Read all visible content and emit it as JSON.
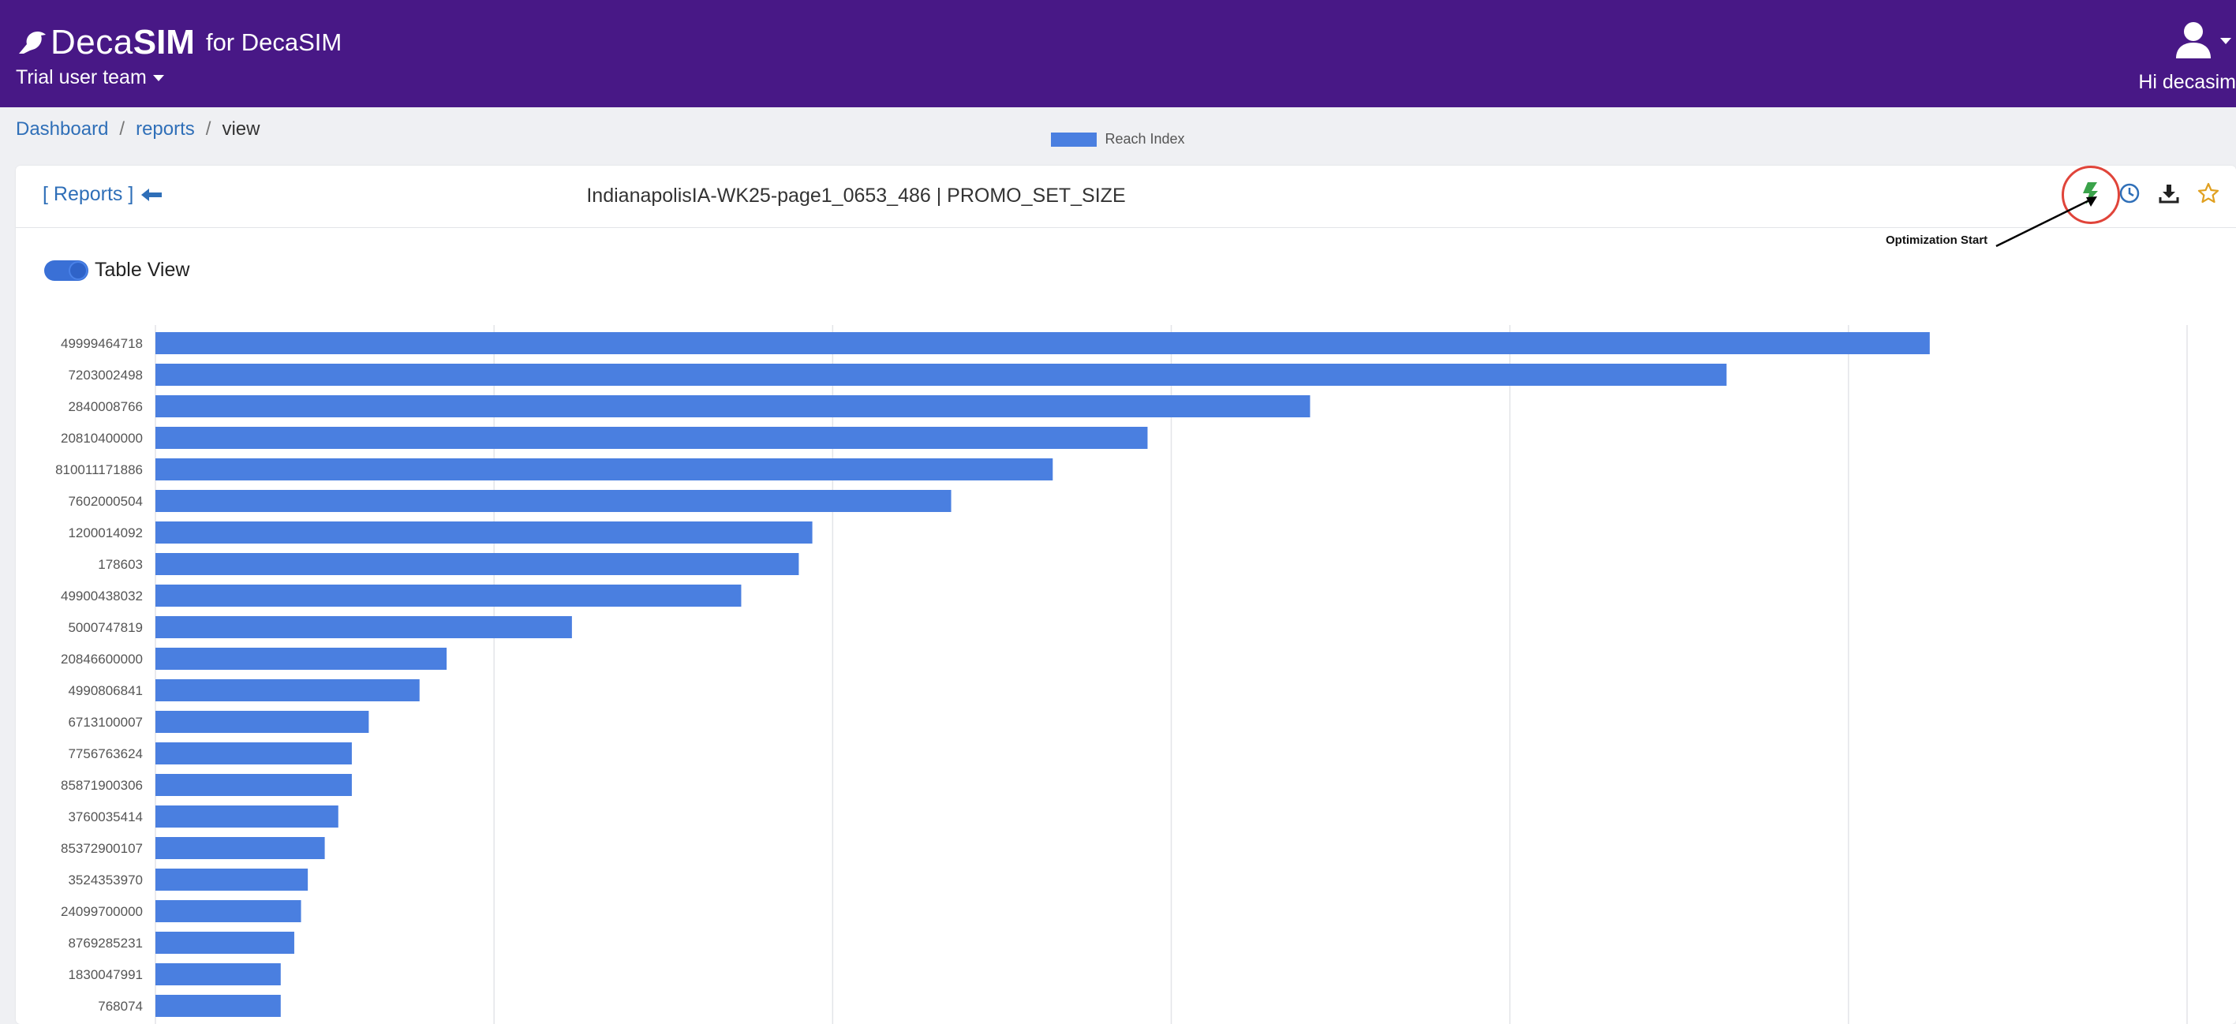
{
  "header": {
    "brand_deca": "Deca",
    "brand_sim": "SIM",
    "brand_for": "for DecaSIM",
    "team": "Trial user team",
    "greeting": "Hi decasim"
  },
  "breadcrumb": {
    "dashboard": "Dashboard",
    "sep1": "/",
    "reports": "reports",
    "sep2": "/",
    "current": "view"
  },
  "card": {
    "back_label": "[ Reports ]",
    "title": "IndianapolisIA-WK25-page1_0653_486 | PROMO_SET_SIZE",
    "annotation": "Optimization Start",
    "toggle_label": "Table View",
    "icons": [
      "bolt-icon",
      "clock-icon",
      "download-icon",
      "star-icon"
    ],
    "colors": {
      "bolt": "#3aa34a",
      "star": "#e0a020",
      "link": "#2f6fb8",
      "highlight": "#e0443a"
    }
  },
  "chart_data": {
    "type": "bar",
    "orientation": "horizontal",
    "legend": [
      "Reach Index"
    ],
    "color": "#4a7fe0",
    "grid": true,
    "categories": [
      "49999464718",
      "7203002498",
      "2840008766",
      "20810400000",
      "810011171886",
      "7602000504",
      "1200014092",
      "178603",
      "49900438032",
      "5000747819",
      "20846600000",
      "4990806841",
      "6713100007",
      "7756763624",
      "85871900306",
      "3760035414",
      "85372900107",
      "3524353970",
      "24099700000",
      "8769285231",
      "1830047991",
      "768074"
    ],
    "series": [
      {
        "name": "Reach Index",
        "values": [
          5.24,
          4.64,
          3.41,
          2.93,
          2.65,
          2.35,
          1.94,
          1.9,
          1.73,
          1.23,
          0.86,
          0.78,
          0.63,
          0.58,
          0.58,
          0.54,
          0.5,
          0.45,
          0.43,
          0.41,
          0.37,
          0.37
        ]
      }
    ],
    "xlim": [
      0,
      6
    ]
  },
  "header_colors": {
    "topbar": "#481886",
    "page_bg": "#eff0f3"
  }
}
